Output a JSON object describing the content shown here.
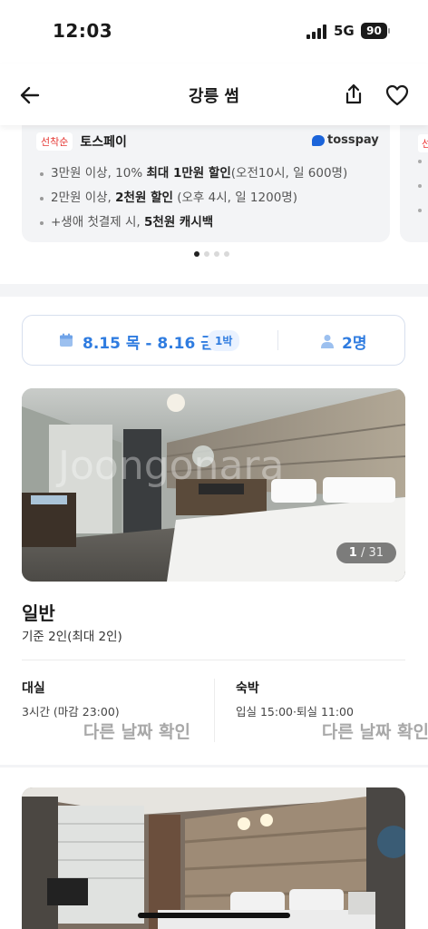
{
  "status_bar": {
    "time": "12:03",
    "network": "5G",
    "battery": "90"
  },
  "nav": {
    "title": "강릉 썸"
  },
  "promo": {
    "badge": "선착순",
    "title": "토스페이",
    "brand": "tosspay",
    "lines": [
      {
        "pre": "3만원 이상, 10% ",
        "bold": "최대 1만원 할인",
        "post": "(오전10시, 일 600명)"
      },
      {
        "pre": "2만원 이상, ",
        "bold": "2천원 할인",
        "post": " (오후 4시, 일 1200명)"
      },
      {
        "pre": "+생애 첫결제 시, ",
        "bold": "5천원 캐시백",
        "post": ""
      }
    ],
    "next_card_badge": "선착"
  },
  "booking": {
    "dates": "8.15 목 - 8.16 금",
    "nights": "1박",
    "guests": "2명"
  },
  "room": {
    "image_counter_current": "1",
    "image_counter_total": "/ 31",
    "watermark": "Joongonara",
    "name": "일반",
    "capacity": "기준 2인(최대 2인)",
    "options": [
      {
        "title": "대실",
        "detail": "3시간 (마감 23:00)",
        "action": "다른 날짜 확인"
      },
      {
        "title": "숙박",
        "detail": "입실 15:00·퇴실 11:00",
        "action": "다른 날짜 확인"
      }
    ]
  },
  "colors": {
    "accent": "#2f7ce0",
    "promo_badge": "#e53935",
    "toss_blue": "#1b64da",
    "muted_action": "#a8a8a8"
  },
  "icons": [
    "back-arrow-icon",
    "share-icon",
    "heart-icon",
    "calendar-icon",
    "person-icon"
  ]
}
